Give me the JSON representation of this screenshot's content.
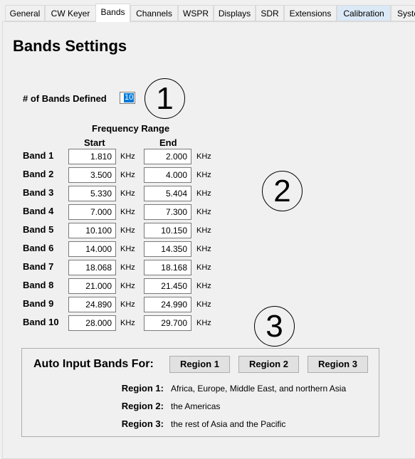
{
  "tabs": [
    {
      "label": "General"
    },
    {
      "label": "CW Keyer"
    },
    {
      "label": "Bands"
    },
    {
      "label": "Channels"
    },
    {
      "label": "WSPR"
    },
    {
      "label": "Displays"
    },
    {
      "label": "SDR"
    },
    {
      "label": "Extensions"
    },
    {
      "label": "Calibration"
    },
    {
      "label": "System"
    }
  ],
  "active_tab": "Bands",
  "page_title": "Bands Settings",
  "num_bands": {
    "label": "# of Bands Defined",
    "value": "10"
  },
  "callouts": [
    "1",
    "2",
    "3"
  ],
  "freq_range": {
    "title": "Frequency Range",
    "start_label": "Start",
    "end_label": "End",
    "unit": "KHz"
  },
  "bands": [
    {
      "label": "Band 1",
      "start": "1.810",
      "end": "2.000"
    },
    {
      "label": "Band 2",
      "start": "3.500",
      "end": "4.000"
    },
    {
      "label": "Band 3",
      "start": "5.330",
      "end": "5.404"
    },
    {
      "label": "Band 4",
      "start": "7.000",
      "end": "7.300"
    },
    {
      "label": "Band 5",
      "start": "10.100",
      "end": "10.150"
    },
    {
      "label": "Band 6",
      "start": "14.000",
      "end": "14.350"
    },
    {
      "label": "Band 7",
      "start": "18.068",
      "end": "18.168"
    },
    {
      "label": "Band 8",
      "start": "21.000",
      "end": "21.450"
    },
    {
      "label": "Band 9",
      "start": "24.890",
      "end": "24.990"
    },
    {
      "label": "Band 10",
      "start": "28.000",
      "end": "29.700"
    }
  ],
  "auto_input": {
    "title": "Auto Input Bands For:",
    "buttons": [
      "Region 1",
      "Region 2",
      "Region 3"
    ],
    "regions": [
      {
        "label": "Region 1:",
        "desc": "Africa, Europe, Middle East, and northern Asia"
      },
      {
        "label": "Region 2:",
        "desc": "the Americas"
      },
      {
        "label": "Region 3:",
        "desc": "the rest of Asia and the Pacific"
      }
    ]
  }
}
